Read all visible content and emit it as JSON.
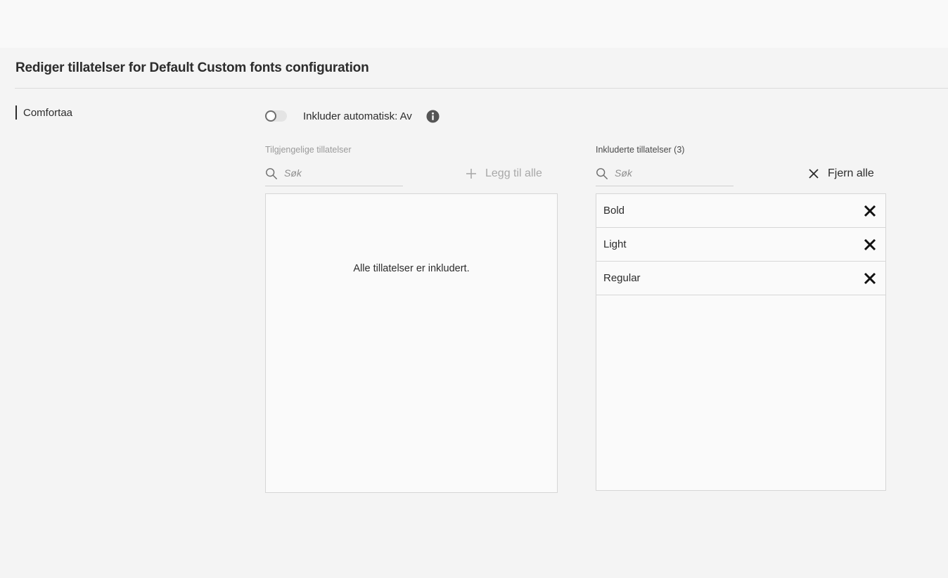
{
  "page": {
    "title": "Rediger tillatelser for Default Custom fonts configuration"
  },
  "nav": {
    "items": [
      {
        "label": "Comfortaa",
        "active": true
      }
    ]
  },
  "auto_include": {
    "label": "Inkluder automatisk: Av",
    "enabled": false
  },
  "available": {
    "heading": "Tilgjengelige tillatelser",
    "search_placeholder": "Søk",
    "add_all_label": "Legg til alle",
    "empty_message": "Alle tillatelser er inkludert.",
    "items": []
  },
  "included": {
    "heading": "Inkluderte tillatelser (3)",
    "search_placeholder": "Søk",
    "remove_all_label": "Fjern alle",
    "items": [
      {
        "label": "Bold"
      },
      {
        "label": "Light"
      },
      {
        "label": "Regular"
      }
    ]
  },
  "colors": {
    "background": "#f4f4f4",
    "text": "#2c2c2c",
    "muted": "#a8a8a8",
    "border": "#d6d6d6"
  }
}
